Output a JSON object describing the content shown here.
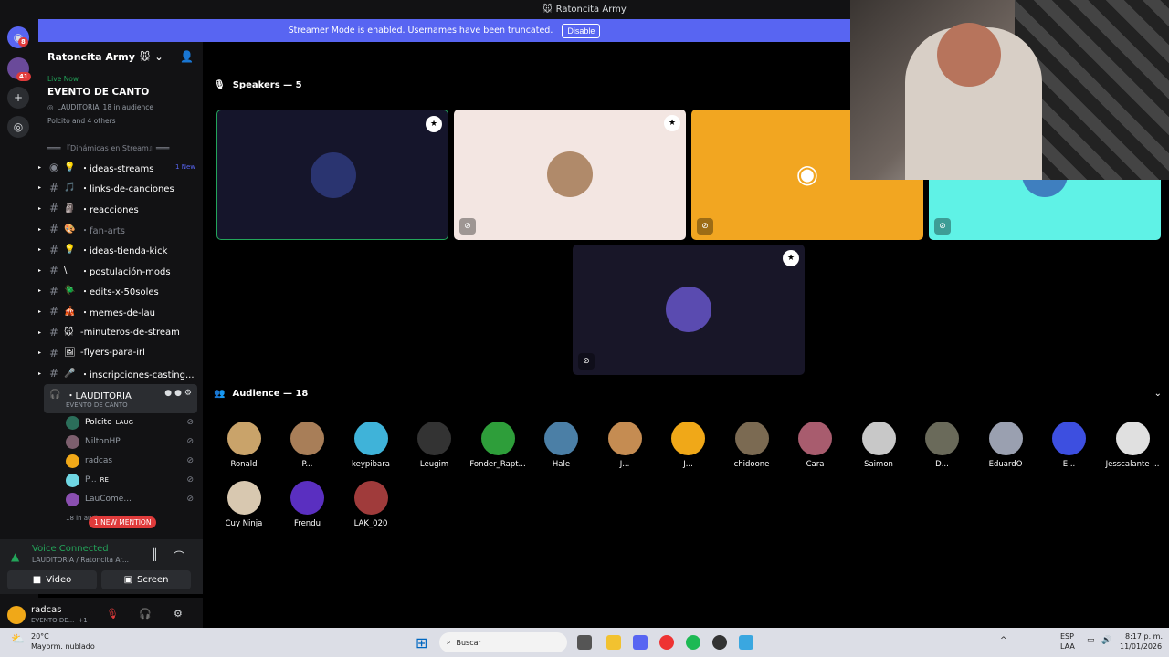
{
  "window": {
    "title": "Ratoncita Army",
    "title_emoji": "🐭"
  },
  "servers": {
    "home_badge": "8",
    "server_badge": "41"
  },
  "streamer_bar": {
    "text": "Streamer Mode is enabled. Usernames have been truncated.",
    "button": "Disable"
  },
  "server_header": {
    "name": "Ratoncita Army",
    "emoji": "🐭"
  },
  "live": {
    "status": "Live Now",
    "event": "EVENTO DE CANTO",
    "channel": "LAUDITORIA",
    "audience": "18 in audience",
    "others": "Polcito and 4 others"
  },
  "category": "═══ 『Dinámicas en Stream』═══",
  "channels": [
    {
      "emoji": "💡",
      "name": "・ideas-streams",
      "new": "1 New",
      "voice": true
    },
    {
      "emoji": "🎵",
      "name": "・links-de-canciones",
      "new": ""
    },
    {
      "emoji": "🗿",
      "name": "・reacciones",
      "new": ""
    },
    {
      "emoji": "🎨",
      "name": "・fan-arts",
      "new": "",
      "muted": true
    },
    {
      "emoji": "💡",
      "name": "・ideas-tienda-kick",
      "new": ""
    },
    {
      "emoji": "\\",
      "name": "・postulación-mods",
      "new": ""
    },
    {
      "emoji": "🪲",
      "name": "・edits-x-50soles",
      "new": ""
    },
    {
      "emoji": "🎪",
      "name": "・memes-de-lau",
      "new": ""
    },
    {
      "emoji": "🐭",
      "name": "-minuteros-de-stream",
      "new": ""
    },
    {
      "emoji": "🖼",
      "name": "-flyers-para-irl",
      "new": ""
    },
    {
      "emoji": "🎤",
      "name": "・inscripciones-casting...",
      "new": ""
    }
  ],
  "voice_channel": {
    "name": "・LAUDITORIA",
    "sub": "EVENTO DE CANTO"
  },
  "voice_users": [
    {
      "name": "Polcito",
      "tag": "LAUG",
      "color": "#2b6e5a",
      "active": true
    },
    {
      "name": "NiltonHP",
      "tag": "",
      "color": "#7d5f6e"
    },
    {
      "name": "radcas",
      "tag": "",
      "color": "#f0a818"
    },
    {
      "name": "P...",
      "tag": "RE",
      "color": "#6fd6e3"
    },
    {
      "name": "LauCome...",
      "tag": "",
      "color": "#8a4fb0"
    }
  ],
  "voice_more": "18 in audience",
  "mention": "1 NEW MENTION",
  "voice_panel": {
    "status": "Voice Connected",
    "path": "LAUDITORIA / Ratoncita Ar...",
    "video": "Video",
    "screen": "Screen"
  },
  "user_panel": {
    "name": "radcas",
    "status": "EVENTO DE...",
    "extra": "+1"
  },
  "speakers_header": "Speakers — 5",
  "audience_header": "Audience — 18",
  "speakers": [
    {
      "bg": "#15152b",
      "avatar": "#2a3470",
      "mod": true,
      "mute": false
    },
    {
      "bg": "#f3e6e2",
      "avatar": "#b08a6a",
      "mod": true,
      "mute": true
    },
    {
      "bg": "#f2a621",
      "avatar": "#f2a621",
      "mod": false,
      "mute": true
    },
    {
      "bg": "#5ff2e6",
      "avatar": "#3f7fbf",
      "mod": false,
      "mute": true
    },
    {
      "bg": "#181628",
      "avatar": "#5a4bb0",
      "mod": true,
      "mute": true
    }
  ],
  "audience": [
    {
      "name": "Ronald",
      "color": "#c9a36a"
    },
    {
      "name": "P...",
      "color": "#a87e58"
    },
    {
      "name": "keypibara",
      "color": "#3fb3d9"
    },
    {
      "name": "Leugim",
      "color": "#333"
    },
    {
      "name": "Fonder_Rapt...",
      "color": "#2e9e3a"
    },
    {
      "name": "Hale",
      "color": "#4b7fa6"
    },
    {
      "name": "J...",
      "color": "#c58c52"
    },
    {
      "name": "J...",
      "color": "#f0a818"
    },
    {
      "name": "chidoone",
      "color": "#7b6a52"
    },
    {
      "name": "Cara",
      "color": "#a85c6e"
    },
    {
      "name": "Saimon",
      "color": "#c8c8c8"
    },
    {
      "name": "D...",
      "color": "#6a6a5a"
    },
    {
      "name": "EduardO",
      "color": "#9aa0b0"
    },
    {
      "name": "E...",
      "color": "#3d4fe0"
    },
    {
      "name": "Jesscalante ...",
      "color": "#e0e0e0"
    },
    {
      "name": "Cuy Ninja",
      "color": "#d8c8b0"
    },
    {
      "name": "Frendu",
      "color": "#5a2fc0"
    },
    {
      "name": "LAK_020",
      "color": "#a03b3b"
    }
  ],
  "taskbar": {
    "temp": "20°C",
    "weather": "Mayorm. nublado",
    "search": "Buscar",
    "lang1": "ESP",
    "lang2": "LAA",
    "time": "8:17 p. m.",
    "date": "11/01/2026"
  }
}
